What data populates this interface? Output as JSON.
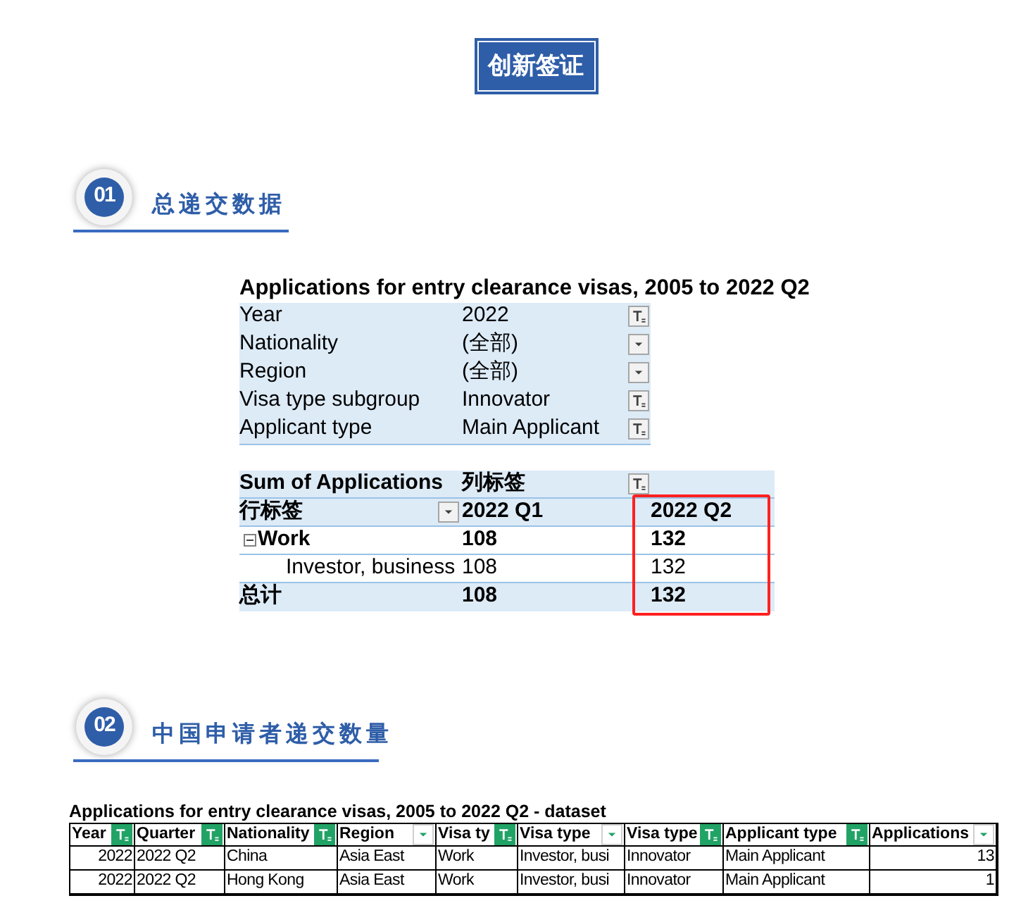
{
  "title": "创新签证",
  "section_1": {
    "number": "01",
    "heading": "总递交数据"
  },
  "pivot": {
    "title": "Applications for entry clearance visas, 2005 to 2022 Q2",
    "filters": [
      {
        "label": "Year",
        "value": "2022",
        "filtered": true
      },
      {
        "label": "Nationality",
        "value": "(全部)",
        "filtered": false
      },
      {
        "label": "Region",
        "value": "(全部)",
        "filtered": false
      },
      {
        "label": "Visa type subgroup",
        "value": "Innovator",
        "filtered": true
      },
      {
        "label": "Applicant type",
        "value": "Main Applicant",
        "filtered": true
      }
    ],
    "value_header": "Sum of Applications",
    "column_label": "列标签",
    "column_filtered": true,
    "row_label": "行标签",
    "row_filtered": false,
    "columns": [
      {
        "label": "2022 Q1",
        "highlighted": false
      },
      {
        "label": "2022 Q2",
        "highlighted": true
      }
    ],
    "rows": [
      {
        "kind": "group",
        "label": "Work",
        "expanded": true,
        "values": [
          "108",
          "132"
        ]
      },
      {
        "kind": "item",
        "label": "Investor, business",
        "values": [
          "108",
          "132"
        ]
      },
      {
        "kind": "total",
        "label": "总计",
        "values": [
          "108",
          "132"
        ]
      }
    ]
  },
  "section_2": {
    "number": "02",
    "heading": "中国申请者递交数量"
  },
  "dataset": {
    "title": "Applications for entry clearance visas, 2005 to 2022 Q2 - dataset",
    "columns": [
      {
        "label": "Year",
        "filtered": true,
        "kind": "number"
      },
      {
        "label": "Quarter",
        "filtered": true,
        "kind": "text"
      },
      {
        "label": "Nationality",
        "filtered": true,
        "kind": "text"
      },
      {
        "label": "Region",
        "filtered": false,
        "kind": "text"
      },
      {
        "label": "Visa ty",
        "filtered": true,
        "kind": "text"
      },
      {
        "label": "Visa type",
        "filtered": false,
        "kind": "text"
      },
      {
        "label": "Visa type",
        "filtered": true,
        "kind": "text"
      },
      {
        "label": "Applicant type",
        "filtered": true,
        "kind": "text"
      },
      {
        "label": "Applications",
        "filtered": false,
        "kind": "number"
      }
    ],
    "rows": [
      [
        "2022",
        "2022 Q2",
        "China",
        "Asia East",
        "Work",
        "Investor, busi",
        "Innovator",
        "Main Applicant",
        "13"
      ],
      [
        "2022",
        "2022 Q2",
        "Hong Kong",
        "Asia East",
        "Work",
        "Investor, busi",
        "Innovator",
        "Main Applicant",
        "1"
      ]
    ]
  }
}
